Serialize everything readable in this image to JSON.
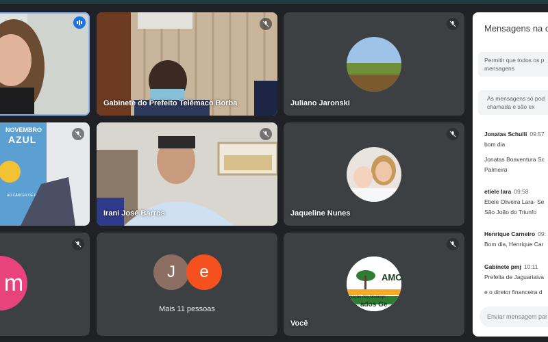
{
  "participants": {
    "tile1": {
      "name": ""
    },
    "tile2": {
      "name": "Gabinete do Prefeito Telêmaco Borba"
    },
    "tile3": {
      "name": "Juliano Jaronski"
    },
    "tile4": {
      "name": "",
      "poster_line1": "NOVEMBRO",
      "poster_line2": "AZUL",
      "poster_line3": "AO CÂNCER DE P"
    },
    "tile5": {
      "name": "Irani José Barros"
    },
    "tile6": {
      "name": "Jaqueline Nunes"
    },
    "tile7": {
      "name": "",
      "initial": "m"
    },
    "tile8": {
      "name": "Mais 11 pessoas",
      "initial_a": "J",
      "initial_b": "e"
    },
    "tile9": {
      "name": "Você",
      "logo_text": "AMC",
      "logo_sub1": "ciação dos Municípi",
      "logo_sub2": "ados Ge"
    }
  },
  "colors": {
    "active_border": "#8ab4f8",
    "speaking_badge": "#1a73e8",
    "avatar_m": "#e8437a",
    "avatar_j": "#8d6e63",
    "avatar_e": "#f4511e"
  },
  "chat": {
    "title": "Mensagens na c",
    "notice1_line1": "Permitir que todos os p",
    "notice1_line2": "mensagens",
    "notice2_line1": "As mensagens só pod",
    "notice2_line2": "chamada e são ex",
    "messages": [
      {
        "sender": "Jonatas Schulli",
        "time": "09:57",
        "lines": [
          "bom dia",
          "",
          "Jonatas Boaventura Sc",
          "Palmeira"
        ]
      },
      {
        "sender": "etiele lara",
        "time": "09:58",
        "lines": [
          "Etiele Oliveira Lara- Se",
          "São João do Triunfo"
        ]
      },
      {
        "sender": "Henrique Carneiro",
        "time": "09:",
        "lines": [
          "Bom dia, Henrique Car"
        ]
      },
      {
        "sender": "Gabinete pmj",
        "time": "10:11",
        "lines": [
          "Prefeita de Jaguariaiva",
          "",
          "e o diretor financeira d"
        ]
      }
    ],
    "input_placeholder": "Enviar mensagem par"
  }
}
